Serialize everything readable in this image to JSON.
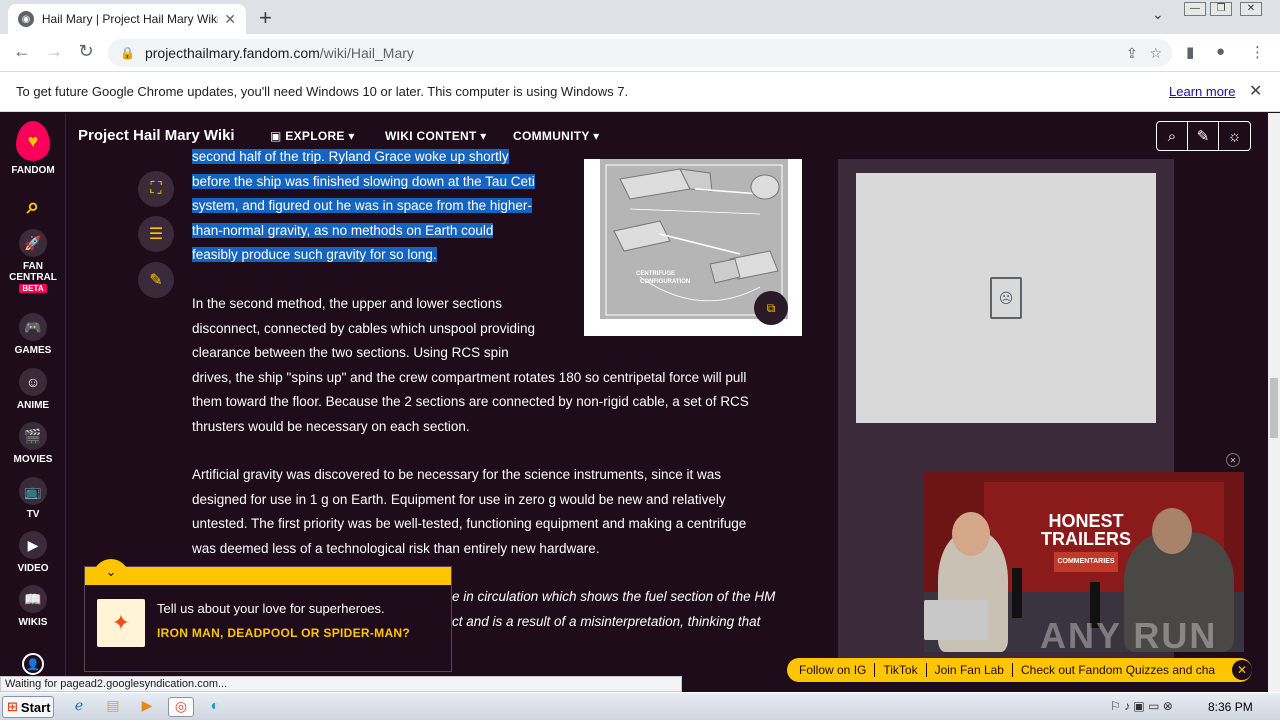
{
  "browser": {
    "tab_title": "Hail Mary | Project Hail Mary Wiki | F",
    "tab_close": "✕",
    "new_tab": "+",
    "url_host": "projecthailmary.fandom.com",
    "url_path": "/wiki/Hail_Mary",
    "infobar_text": "To get future Google Chrome updates, you'll need Windows 10 or later. This computer is using Windows 7.",
    "infobar_link": "Learn more",
    "infobar_close": "✕"
  },
  "rail": {
    "brand": "FANDOM",
    "items": [
      {
        "label": "FAN CENTRAL",
        "badge": "BETA"
      },
      {
        "label": "GAMES"
      },
      {
        "label": "ANIME"
      },
      {
        "label": "MOVIES"
      },
      {
        "label": "TV"
      },
      {
        "label": "VIDEO"
      },
      {
        "label": "WIKIS"
      }
    ]
  },
  "header": {
    "wiki_name": "Project Hail Mary Wiki",
    "nav": [
      "EXPLORE",
      "WIKI CONTENT",
      "COMMUNITY"
    ]
  },
  "article": {
    "hl_lines": [
      "second half of the trip. Ryland Grace woke up shortly",
      "before the ship was finished slowing down at the Tau Ceti",
      "system, and figured out he was in space from the higher-",
      "than-normal gravity, as no methods on Earth could",
      "feasibly produce such gravity for so long."
    ],
    "p2_lines": [
      "In the second method, the upper and lower sections",
      "disconnect, connected by cables which unspool providing",
      "clearance between the two sections. Using RCS spin",
      "drives, the ship \"spins up\" and the crew compartment rotates 180 so centripetal force will pull",
      "them toward the floor. Because the 2 sections are connected by non-rigid cable, a set of RCS",
      "thrusters would be necessary on each section."
    ],
    "p3_lines": [
      "Artificial gravity was discovered to be necessary for the science instruments, since it was",
      "designed for use in 1 g on Earth. Equipment for use in zero g would be new and relatively",
      "untested. The first priority was be well-tested, functioning equipment and making a centrifuge",
      "was deemed less of a technological risk than entirely new hardware."
    ],
    "p4_lines": [
      "e in circulation which shows the fuel section of the HM",
      "ct and is a result of a misinterpretation, thinking that"
    ],
    "figure_labels": [
      "CENTRIFUGE",
      "CONFIGURATION"
    ]
  },
  "notification": {
    "question": "Tell us about your love for superheroes.",
    "answer": "IRON MAN, DEADPOOL OR SPIDER-MAN?"
  },
  "video": {
    "title_line1": "HONEST",
    "title_line2": "TRAILERS",
    "subtitle": "COMMENTARIES"
  },
  "pillbar": [
    "Follow on IG",
    "TikTok",
    "Join Fan Lab",
    "Check out Fandom Quizzes and cha"
  ],
  "status_text": "Waiting for pagead2.googlesyndication.com...",
  "taskbar": {
    "start_label": "Start",
    "clock": "8:36 PM"
  },
  "watermark": "ANY RUN"
}
